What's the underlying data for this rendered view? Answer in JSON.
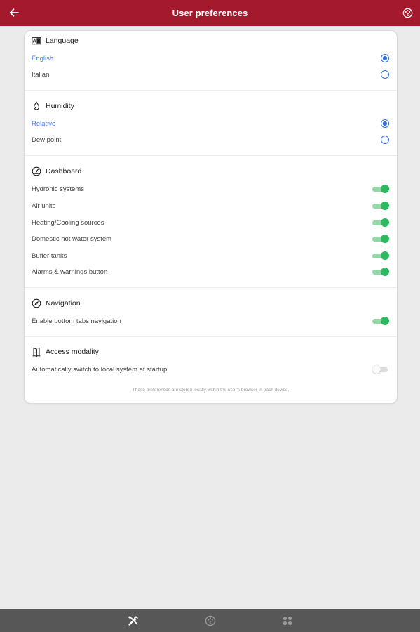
{
  "header": {
    "title": "User preferences",
    "left_icon": "back-arrow-icon",
    "right_icon": "palette-icon",
    "background": "#a5192c"
  },
  "sections": {
    "language": {
      "title": "Language",
      "icon": "language-icon",
      "options": [
        {
          "label": "English",
          "selected": true
        },
        {
          "label": "Italian",
          "selected": false
        }
      ]
    },
    "humidity": {
      "title": "Humidity",
      "icon": "water-drop-icon",
      "options": [
        {
          "label": "Relative",
          "selected": true
        },
        {
          "label": "Dew point",
          "selected": false
        }
      ]
    },
    "dashboard": {
      "title": "Dashboard",
      "icon": "gauge-icon",
      "toggles": [
        {
          "label": "Hydronic systems",
          "on": true
        },
        {
          "label": "Air units",
          "on": true
        },
        {
          "label": "Heating/Cooling sources",
          "on": true
        },
        {
          "label": "Domestic hot water system",
          "on": true
        },
        {
          "label": "Buffer tanks",
          "on": true
        },
        {
          "label": "Alarms & warnings button",
          "on": true
        }
      ]
    },
    "navigation": {
      "title": "Navigation",
      "icon": "compass-icon",
      "toggles": [
        {
          "label": "Enable bottom tabs navigation",
          "on": true
        }
      ]
    },
    "access": {
      "title": "Access modality",
      "icon": "door-icon",
      "toggles": [
        {
          "label": "Automatically switch to local system at startup",
          "on": false
        }
      ]
    }
  },
  "footnote": "These preferences are stored locally within the user's browser in each device.",
  "bottom_tabs": [
    {
      "icon": "tools-icon",
      "active": true
    },
    {
      "icon": "palette-icon",
      "active": false
    },
    {
      "icon": "apps-grid-icon",
      "active": false
    }
  ],
  "colors": {
    "accent_blue": "#2f6fe0",
    "toggle_green": "#2eb860",
    "bottom_bar": "#575757"
  }
}
